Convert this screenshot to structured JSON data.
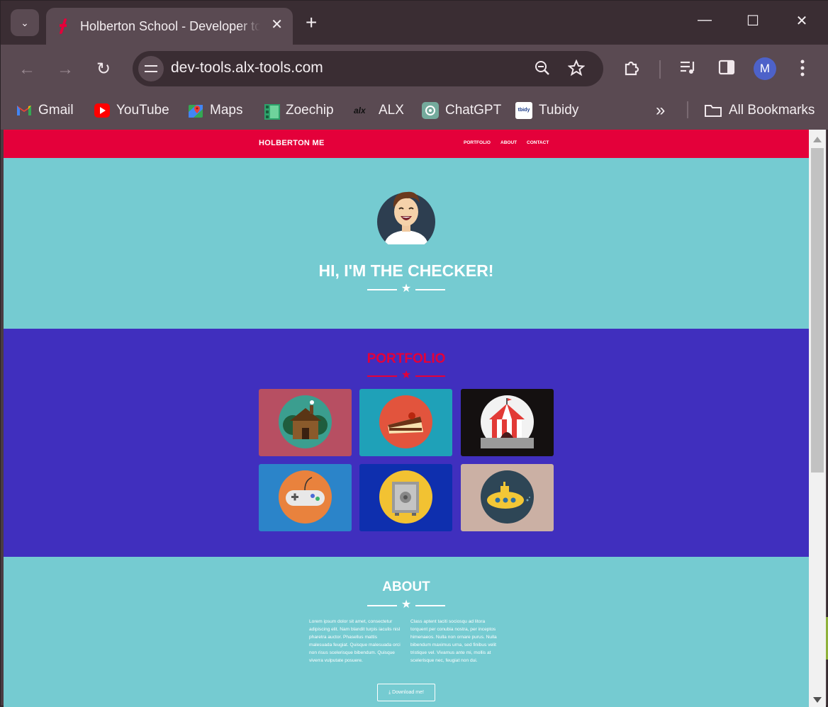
{
  "browser": {
    "tab_title": "Holberton School - Developer tools",
    "new_tab_symbol": "+",
    "url": "dev-tools.alx-tools.com",
    "profile_initial": "M",
    "bookmarks": [
      "Gmail",
      "YouTube",
      "Maps",
      "Zoechip",
      "ALX",
      "ChatGPT",
      "Tubidy"
    ],
    "bookmarks_overflow": "»",
    "all_bookmarks": "All Bookmarks",
    "icons": [
      "tab-search-icon",
      "back-icon",
      "forward-icon",
      "reload-icon",
      "site-info-icon",
      "zoom-icon",
      "star-icon",
      "extensions-icon",
      "media-icon",
      "side-panel-icon",
      "menu-icon",
      "minimize-icon",
      "maximize-icon",
      "close-icon",
      "folder-icon"
    ]
  },
  "site": {
    "brand": "HOLBERTON ME",
    "nav": [
      "PORTFOLIO",
      "ABOUT",
      "CONTACT"
    ],
    "hero_title": "HI, I'M THE CHECKER!",
    "portfolio_title": "PORTFOLIO",
    "about_title": "ABOUT",
    "about_left": "Lorem ipsum dolor sit amet, consectetur adipiscing elit. Nam blandit turpis iaculis nisl pharetra auctor. Phasellus mattis malesuada feugiat. Quisque malesuada orci non risus scelerisque bibendum. Quisque viverra vulputate posuere.",
    "about_right": "Class aptent taciti sociosqu ad litora torquent per conubia nostra, per inceptos himenaeos. Nulla non ornare purus. Nulla bibendum maximus urna, sed finibus velit tristique vel. Vivamus ante mi, mollis at scelerisque nec, feugiat non dui.",
    "download_label": "Download me!",
    "portfolio_items": [
      "cabin",
      "cake",
      "circus",
      "game-controller",
      "safe",
      "submarine"
    ]
  },
  "colors": {
    "accent_red": "#e4003a",
    "teal": "#75cbd1",
    "purple": "#402fbe"
  }
}
